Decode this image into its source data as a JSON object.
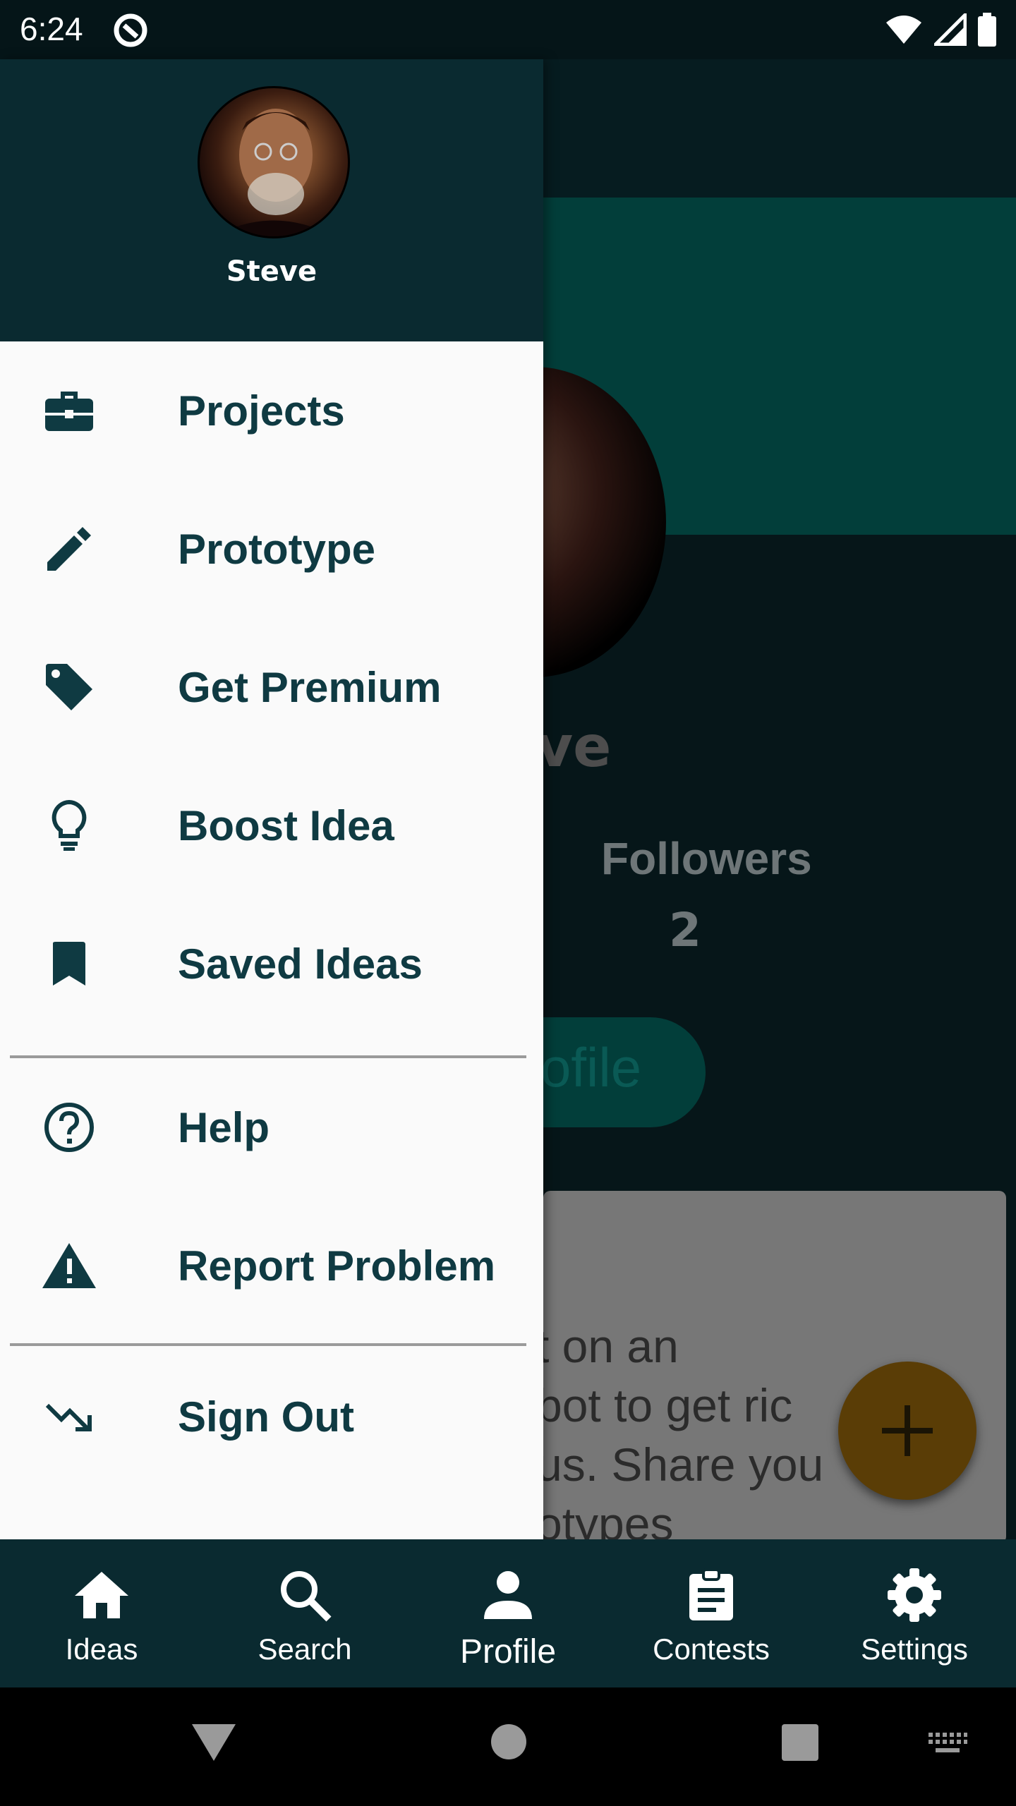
{
  "status_bar": {
    "time": "6:24"
  },
  "drawer": {
    "user_name": "Steve",
    "menu": [
      {
        "label": "Projects",
        "icon": "briefcase-icon"
      },
      {
        "label": "Prototype",
        "icon": "pencil-icon"
      },
      {
        "label": "Get Premium",
        "icon": "tag-icon"
      },
      {
        "label": "Boost Idea",
        "icon": "lightbulb-icon"
      },
      {
        "label": "Saved Ideas",
        "icon": "bookmark-icon"
      }
    ],
    "secondary": [
      {
        "label": "Help",
        "icon": "help-circle-icon"
      },
      {
        "label": "Report Problem",
        "icon": "warning-icon"
      }
    ],
    "sign_out": {
      "label": "Sign Out",
      "icon": "trending-down-icon"
    }
  },
  "background": {
    "name_partial": "ve",
    "followers_label": "Followers",
    "followers_count": "2",
    "profile_button_partial": "ofile",
    "card_text_lines": [
      "t on an",
      "bot to get ric",
      "us. Share you",
      "otypes"
    ]
  },
  "bottom_nav": {
    "items": [
      {
        "label": "Ideas",
        "icon": "home-icon"
      },
      {
        "label": "Search",
        "icon": "search-icon"
      },
      {
        "label": "Profile",
        "icon": "person-icon",
        "active": true
      },
      {
        "label": "Contests",
        "icon": "clipboard-icon"
      },
      {
        "label": "Settings",
        "icon": "gear-icon"
      }
    ]
  },
  "colors": {
    "drawer_header": "#0a2a30",
    "accent": "#023e3a",
    "menu_text": "#0f3a42",
    "fab": "#5a3d06"
  }
}
